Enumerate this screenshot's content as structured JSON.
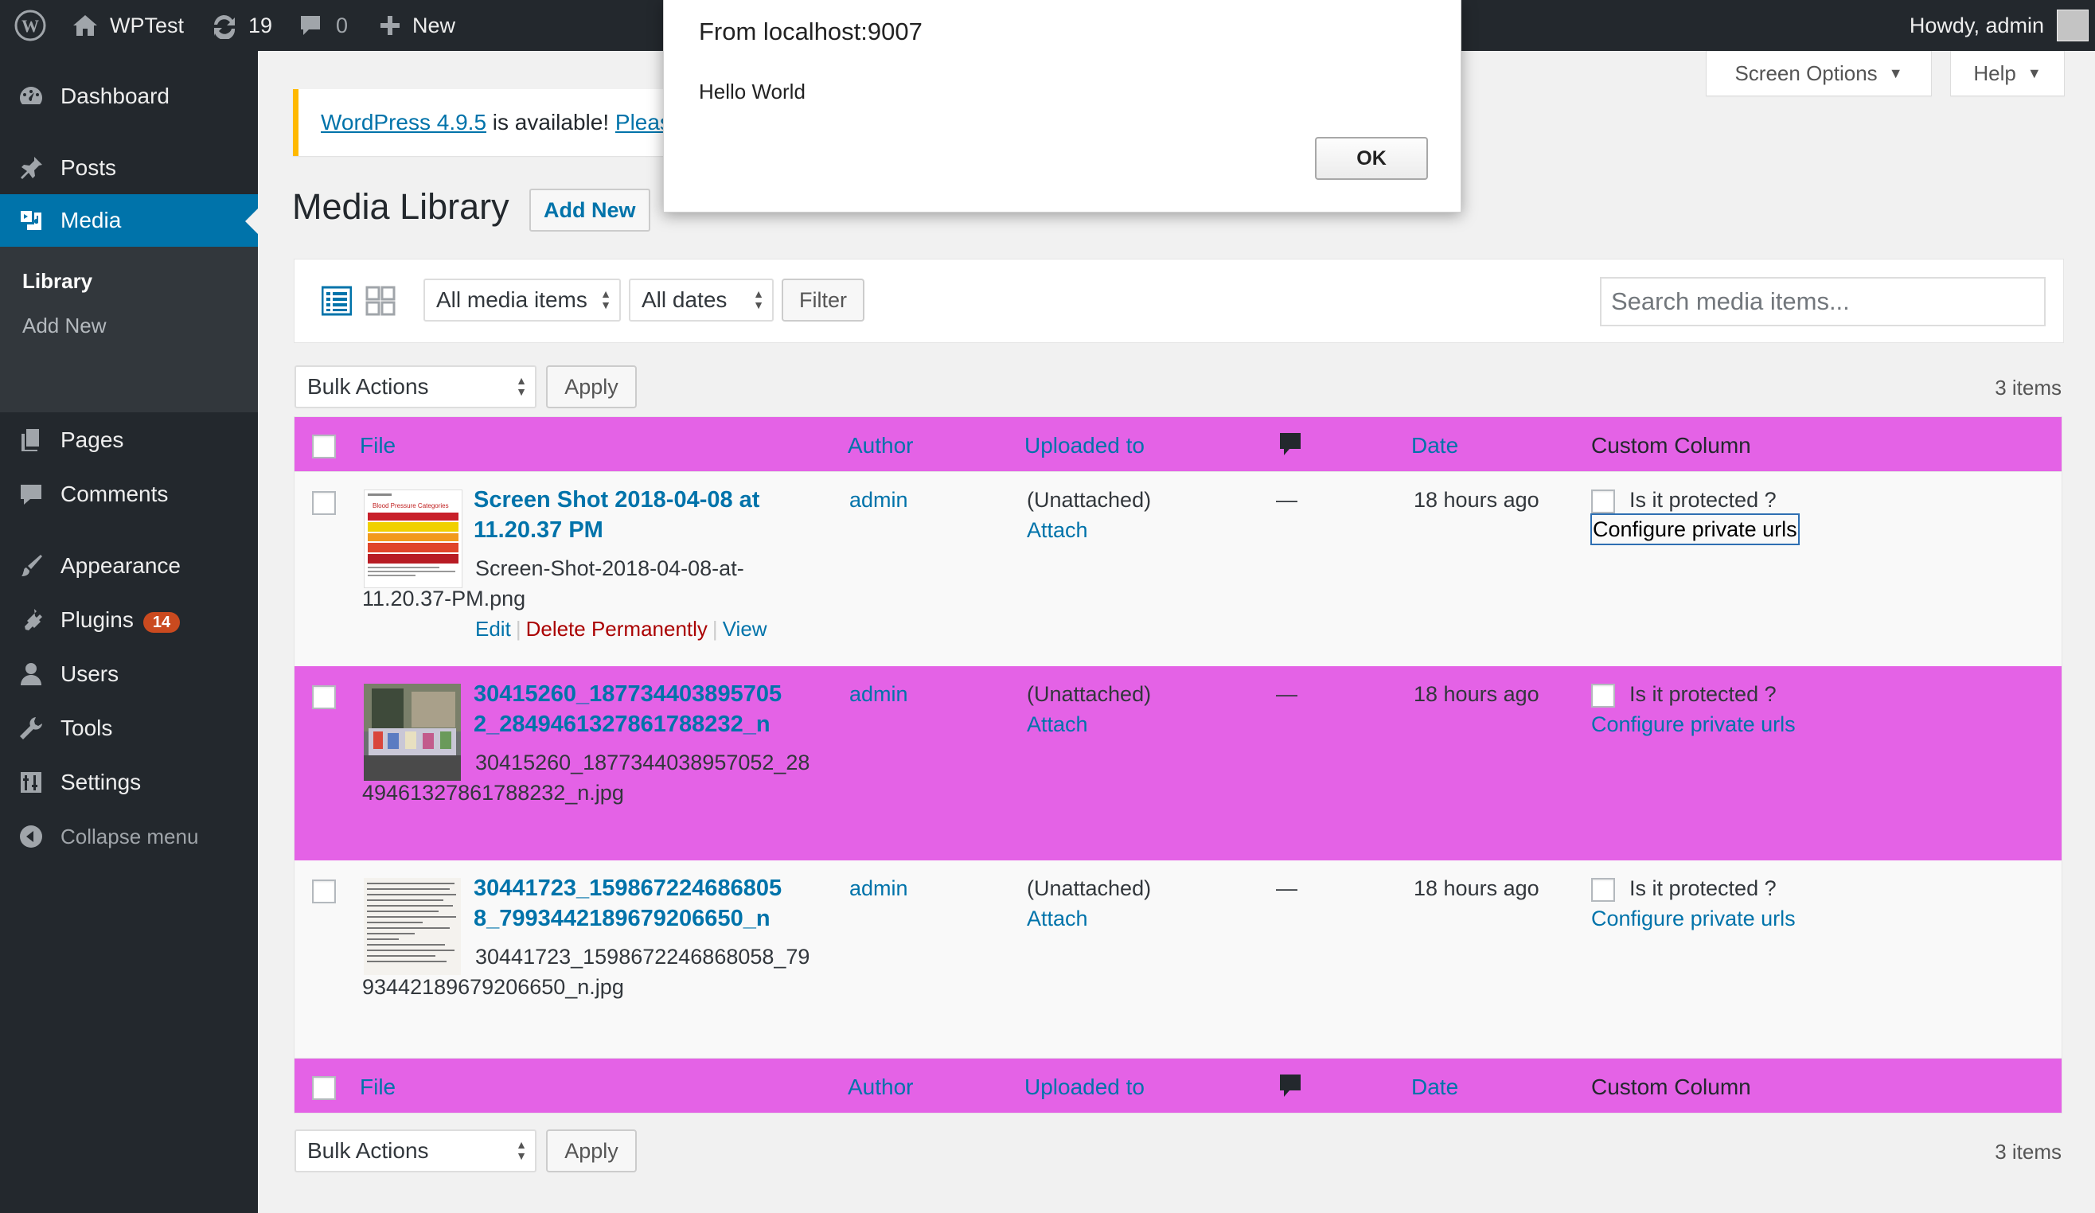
{
  "admin_bar": {
    "site_name": "WPTest",
    "updates_count": "19",
    "comments_count": "0",
    "new_label": "New",
    "greeting": "Howdy, admin"
  },
  "sidebar": {
    "items": [
      {
        "label": "Dashboard",
        "icon": "dashboard-icon"
      },
      {
        "label": "Posts",
        "icon": "pin-icon"
      },
      {
        "label": "Media",
        "icon": "media-icon"
      },
      {
        "label": "Pages",
        "icon": "pages-icon"
      },
      {
        "label": "Comments",
        "icon": "comment-icon"
      },
      {
        "label": "Appearance",
        "icon": "brush-icon"
      },
      {
        "label": "Plugins",
        "icon": "plugin-icon",
        "badge": "14"
      },
      {
        "label": "Users",
        "icon": "user-icon"
      },
      {
        "label": "Tools",
        "icon": "wrench-icon"
      },
      {
        "label": "Settings",
        "icon": "settings-icon"
      },
      {
        "label": "Collapse menu",
        "icon": "collapse-icon"
      }
    ],
    "submenu": [
      "Library",
      "Add New"
    ]
  },
  "notice": {
    "version_link": "WordPress 4.9.5",
    "text": " is available! ",
    "please_link": "Please update now."
  },
  "screen_meta": {
    "screen_options": "Screen Options",
    "help": "Help"
  },
  "page": {
    "title": "Media Library",
    "add_new": "Add New"
  },
  "filters": {
    "media_type": "All media items",
    "dates": "All dates",
    "filter_button": "Filter",
    "search_placeholder": "Search media items..."
  },
  "bulk": {
    "action": "Bulk Actions",
    "apply": "Apply",
    "items_count": "3 items"
  },
  "table": {
    "headers": {
      "file": "File",
      "author": "Author",
      "uploaded_to": "Uploaded to",
      "date": "Date",
      "custom": "Custom Column"
    },
    "rows": [
      {
        "title_line1": "Screen Shot 2018-04-08 at",
        "title_line2": "11.20.37 PM",
        "filename_line1": "Screen-Shot-2018-04-08-at-",
        "filename_line2": "11.20.37-PM.png",
        "author": "admin",
        "uploaded_to": "(Unattached)",
        "attach": "Attach",
        "comments": "—",
        "date": "18 hours ago",
        "protected_label": "Is it protected ?",
        "configure": "Configure private urls",
        "actions": {
          "edit": "Edit",
          "delete": "Delete Permanently",
          "view": "View"
        },
        "thumb_heading": "Blood Pressure Categories"
      },
      {
        "title_line1": "30415260_187734403895705",
        "title_line2": "2_2849461327861788232_n",
        "filename_line1": "30415260_1877344038957052_28",
        "filename_line2": "49461327861788232_n.jpg",
        "author": "admin",
        "uploaded_to": "(Unattached)",
        "attach": "Attach",
        "comments": "—",
        "date": "18 hours ago",
        "protected_label": "Is it protected ?",
        "configure": "Configure private urls"
      },
      {
        "title_line1": "30441723_159867224686805",
        "title_line2": "8_7993442189679206650_n",
        "filename_line1": "30441723_1598672246868058_79",
        "filename_line2": "93442189679206650_n.jpg",
        "author": "admin",
        "uploaded_to": "(Unattached)",
        "attach": "Attach",
        "comments": "—",
        "date": "18 hours ago",
        "protected_label": "Is it protected ?",
        "configure": "Configure private urls"
      }
    ]
  },
  "dialog": {
    "title": "From localhost:9007",
    "message": "Hello World",
    "ok": "OK"
  },
  "colors": {
    "admin_bar": "#23282d",
    "menu_active": "#0073aa",
    "link": "#0073aa",
    "highlight_row": "#e462e6",
    "notice_border": "#ffb900",
    "badge": "#ca4a1f"
  }
}
